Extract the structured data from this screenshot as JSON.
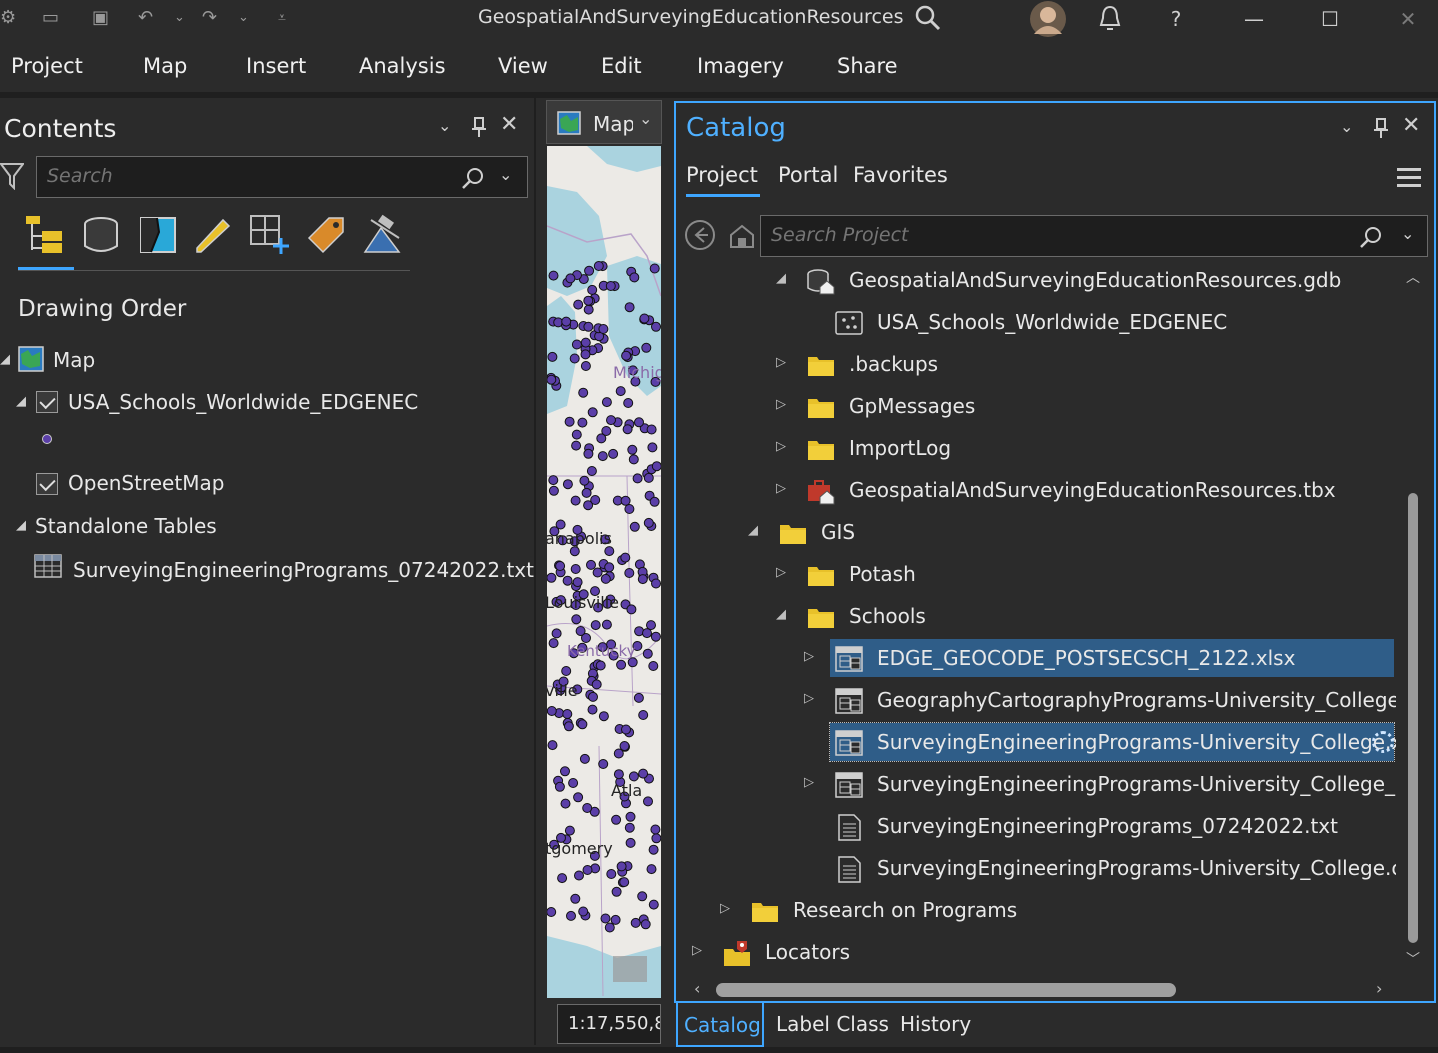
{
  "window": {
    "title": "GeospatialAndSurveyingEducationResources",
    "help": "?"
  },
  "ribbon": {
    "tabs": [
      "Project",
      "Map",
      "Insert",
      "Analysis",
      "View",
      "Edit",
      "Imagery",
      "Share"
    ]
  },
  "contents": {
    "title": "Contents",
    "search_placeholder": "Search",
    "heading": "Drawing Order",
    "map_label": "Map",
    "layer_schools": "USA_Schools_Worldwide_EDGENEC",
    "layer_osm": "OpenStreetMap",
    "standalone_heading": "Standalone Tables",
    "table_item": "SurveyingEngineeringPrograms_07242022.txt",
    "tool_icons": [
      "list-by-drawing-order-icon",
      "list-by-source-icon",
      "list-by-selection-icon",
      "list-by-editing-icon",
      "list-by-snapping-icon",
      "list-by-labeling-icon",
      "list-by-perspective-imagery-icon"
    ]
  },
  "map": {
    "tab_label": "Map",
    "labels": [
      "Michig",
      "anapolis",
      "Louisville",
      "Kentucky",
      "ville",
      "Atla",
      "tgomery"
    ],
    "scale": "1:17,550,8"
  },
  "catalog": {
    "title": "Catalog",
    "tabs": [
      "Project",
      "Portal",
      "Favorites"
    ],
    "search_placeholder": "Search Project",
    "items": [
      {
        "label": "GeospatialAndSurveyingEducationResources.gdb",
        "icon": "geodatabase-home-icon",
        "expander": "open",
        "indent": 1
      },
      {
        "label": "USA_Schools_Worldwide_EDGENEC",
        "icon": "point-feature-class-icon",
        "expander": "none",
        "indent": 2
      },
      {
        "label": ".backups",
        "icon": "folder-icon",
        "expander": "closed",
        "indent": 1
      },
      {
        "label": "GpMessages",
        "icon": "folder-icon",
        "expander": "closed",
        "indent": 1
      },
      {
        "label": "ImportLog",
        "icon": "folder-icon",
        "expander": "closed",
        "indent": 1
      },
      {
        "label": "GeospatialAndSurveyingEducationResources.tbx",
        "icon": "toolbox-home-icon",
        "expander": "closed",
        "indent": 1
      },
      {
        "label": "GIS",
        "icon": "folder-icon",
        "expander": "open",
        "indent": 0
      },
      {
        "label": "Potash",
        "icon": "folder-icon",
        "expander": "closed",
        "indent": 1
      },
      {
        "label": "Schools",
        "icon": "folder-icon",
        "expander": "open",
        "indent": 1
      },
      {
        "label": "EDGE_GEOCODE_POSTSECSCH_2122.xlsx",
        "icon": "excel-workbook-icon",
        "expander": "closed",
        "indent": 2,
        "state": "selected"
      },
      {
        "label": "GeographyCartographyPrograms-University_College_Map_F",
        "icon": "excel-workbook-icon",
        "expander": "closed",
        "indent": 2
      },
      {
        "label": "SurveyingEngineeringPrograms-University_College.xlsx",
        "icon": "excel-workbook-icon",
        "expander": "none",
        "indent": 2,
        "state": "focused"
      },
      {
        "label": "SurveyingEngineeringPrograms-University_College_Map_Re",
        "icon": "excel-workbook-icon",
        "expander": "closed",
        "indent": 2
      },
      {
        "label": "SurveyingEngineeringPrograms_07242022.txt",
        "icon": "text-file-icon",
        "expander": "none",
        "indent": 2
      },
      {
        "label": "SurveyingEngineeringPrograms-University_College.csv",
        "icon": "text-file-icon",
        "expander": "none",
        "indent": 2
      },
      {
        "label": "Research on Programs",
        "icon": "folder-icon",
        "expander": "closed",
        "indent": -1
      },
      {
        "label": "Locators",
        "icon": "locators-icon",
        "expander": "closed",
        "indent": -2
      }
    ]
  },
  "bottom_tabs": [
    "Catalog",
    "Label Class",
    "History"
  ],
  "colors": {
    "accent": "#3ea6ff",
    "selection": "#2f5d88",
    "folder": "#e8c12a",
    "point": "#5b3fa8"
  }
}
